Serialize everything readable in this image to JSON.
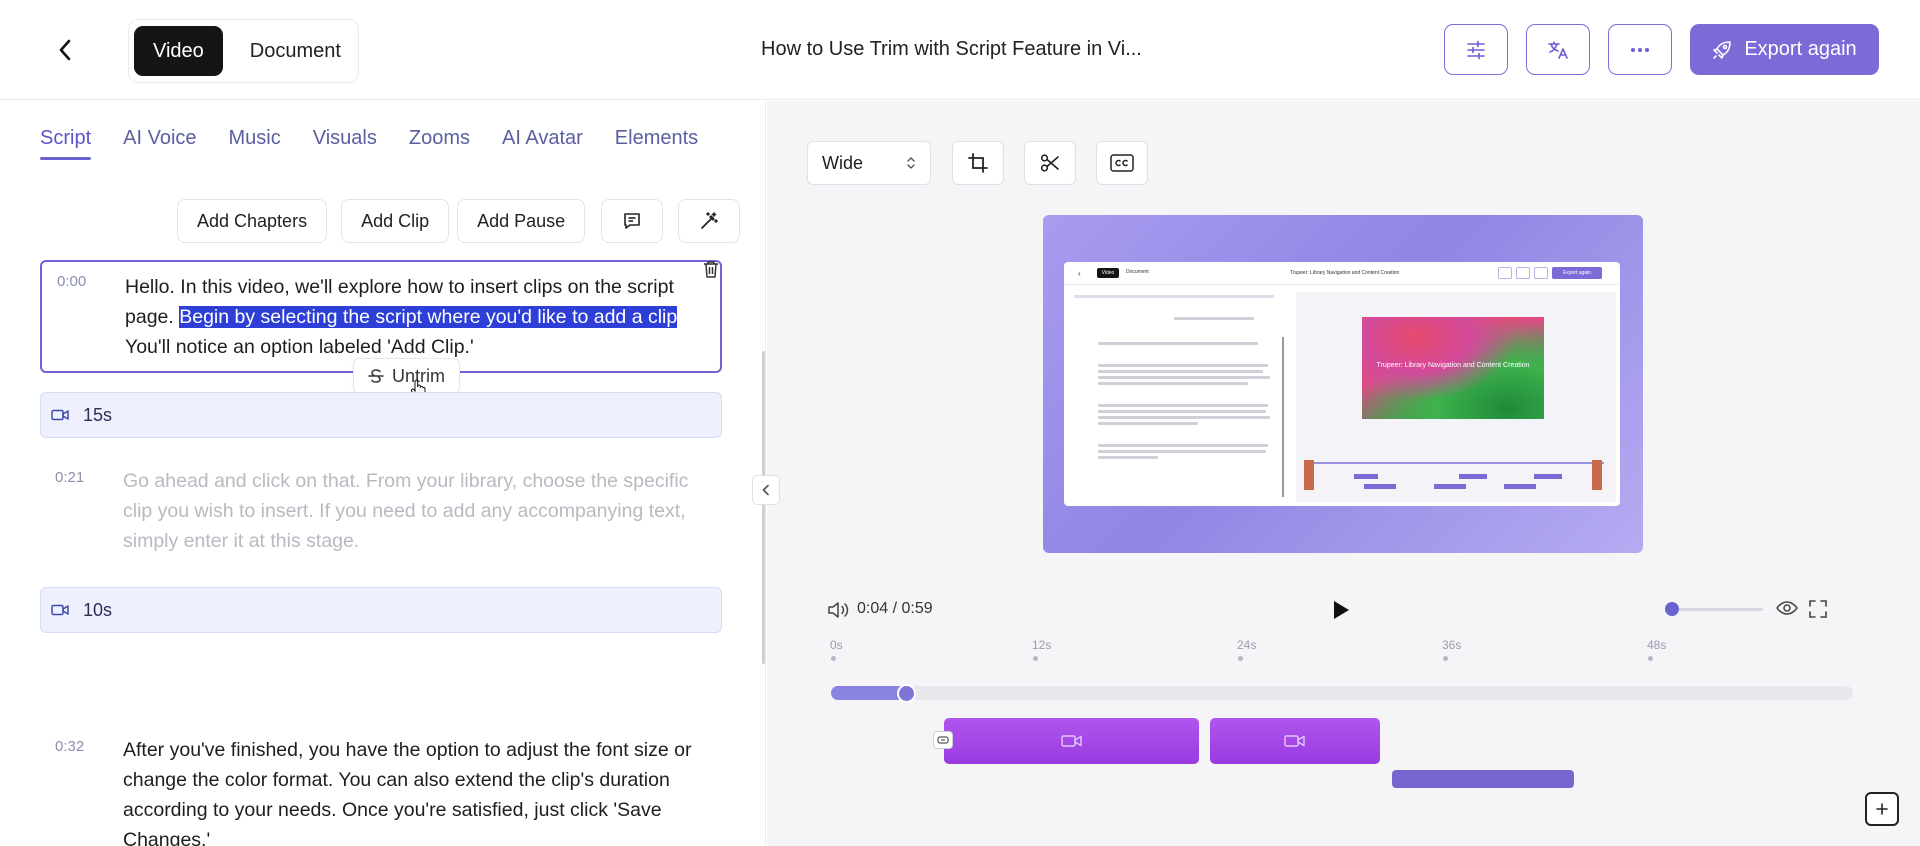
{
  "header": {
    "mode_tabs": [
      {
        "label": "Video"
      },
      {
        "label": "Document"
      }
    ],
    "title": "How to Use Trim with Script Feature in Vi...",
    "export_label": "Export again"
  },
  "left": {
    "tabs": [
      "Script",
      "AI Voice",
      "Music",
      "Visuals",
      "Zooms",
      "AI Avatar",
      "Elements"
    ],
    "active_tab": "Script",
    "toolbar": {
      "add_chapters": "Add Chapters",
      "add_clip": "Add Clip",
      "add_pause": "Add Pause"
    },
    "segments": [
      {
        "time": "0:00",
        "text_before": "Hello. In this video, we'll explore how to insert clips on the script page. ",
        "text_highlight": "Begin by selecting the script where you'd like to add a clip",
        "text_after": " You'll notice an option labeled 'Add Clip.'"
      },
      {
        "time": "0:21",
        "text": "Go ahead and click on that. From your library, choose the specific clip you wish to insert. If you need to add any accompanying text, simply enter it at this stage."
      },
      {
        "time": "0:32",
        "text": "After you've finished, you have the option to adjust the font size or change the color format. You can also extend the clip's duration according to your needs. Once you're satisfied, just click 'Save Changes.'"
      }
    ],
    "clips": [
      {
        "duration": "15s"
      },
      {
        "duration": "10s"
      }
    ],
    "untrim_label": "Untrim"
  },
  "right": {
    "aspect": "Wide",
    "preview": {
      "mini_title": "Trupeer: Library Navigation and Content Creation",
      "mini_button": "Export again",
      "mini_tab_video": "Video",
      "mini_tab_doc": "Document",
      "mini_doc_title": "Trupeer: Library Navigation and Content Creation"
    },
    "player": {
      "current": "0:04",
      "total": "0:59",
      "separator": " / ",
      "progress_fraction": 0.07,
      "volume_fraction": 0.0
    },
    "ruler": [
      "0s",
      "12s",
      "24s",
      "36s",
      "48s"
    ]
  },
  "colors": {
    "accent": "#7b6bd6",
    "highlight": "#2d3fd6",
    "clip": "#a648e8"
  }
}
